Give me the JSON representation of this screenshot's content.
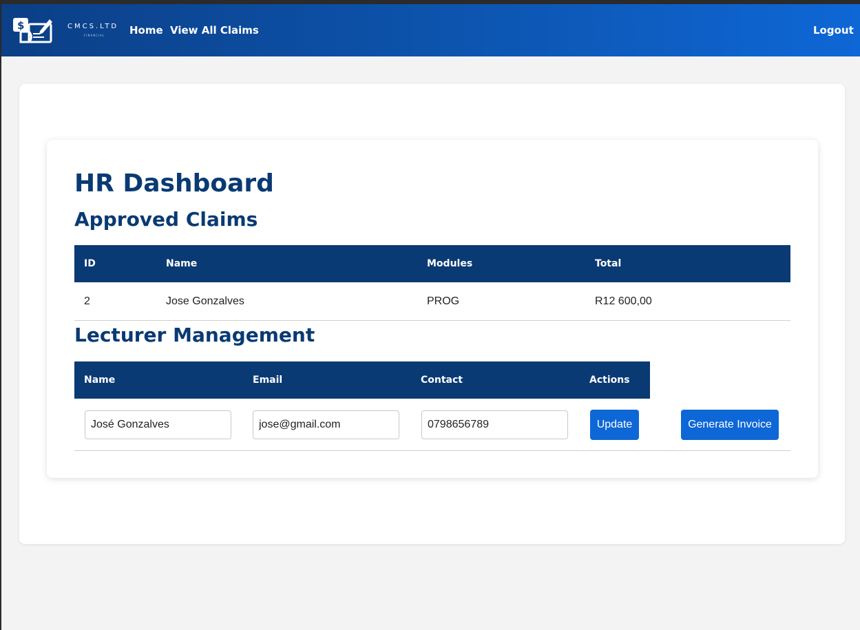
{
  "navbar": {
    "logo_text": "CMCS.LTD",
    "logo_subtext": "FINANCIAL",
    "links": [
      "Home",
      "View All Claims"
    ],
    "logout_label": "Logout",
    "colors": {
      "start": "#0b3f86",
      "end": "#0e67d6"
    }
  },
  "page": {
    "title": "HR Dashboard"
  },
  "approved_claims": {
    "heading": "Approved Claims",
    "columns": [
      "ID",
      "Name",
      "Modules",
      "Total"
    ],
    "rows": [
      {
        "id": "2",
        "name": "Jose Gonzalves",
        "modules": "PROG",
        "total": "R12 600,00"
      }
    ]
  },
  "lecturer_management": {
    "heading": "Lecturer Management",
    "columns": [
      "Name",
      "Email",
      "Contact",
      "Actions"
    ],
    "rows": [
      {
        "name": "José Gonzalves",
        "email": "jose@gmail.com",
        "contact": "0798656789",
        "update_label": "Update",
        "invoice_label": "Generate Invoice"
      }
    ]
  },
  "colors": {
    "header_blue": "#0a3a73",
    "button_blue": "#0e67d6",
    "background": "#f3f3f3"
  }
}
